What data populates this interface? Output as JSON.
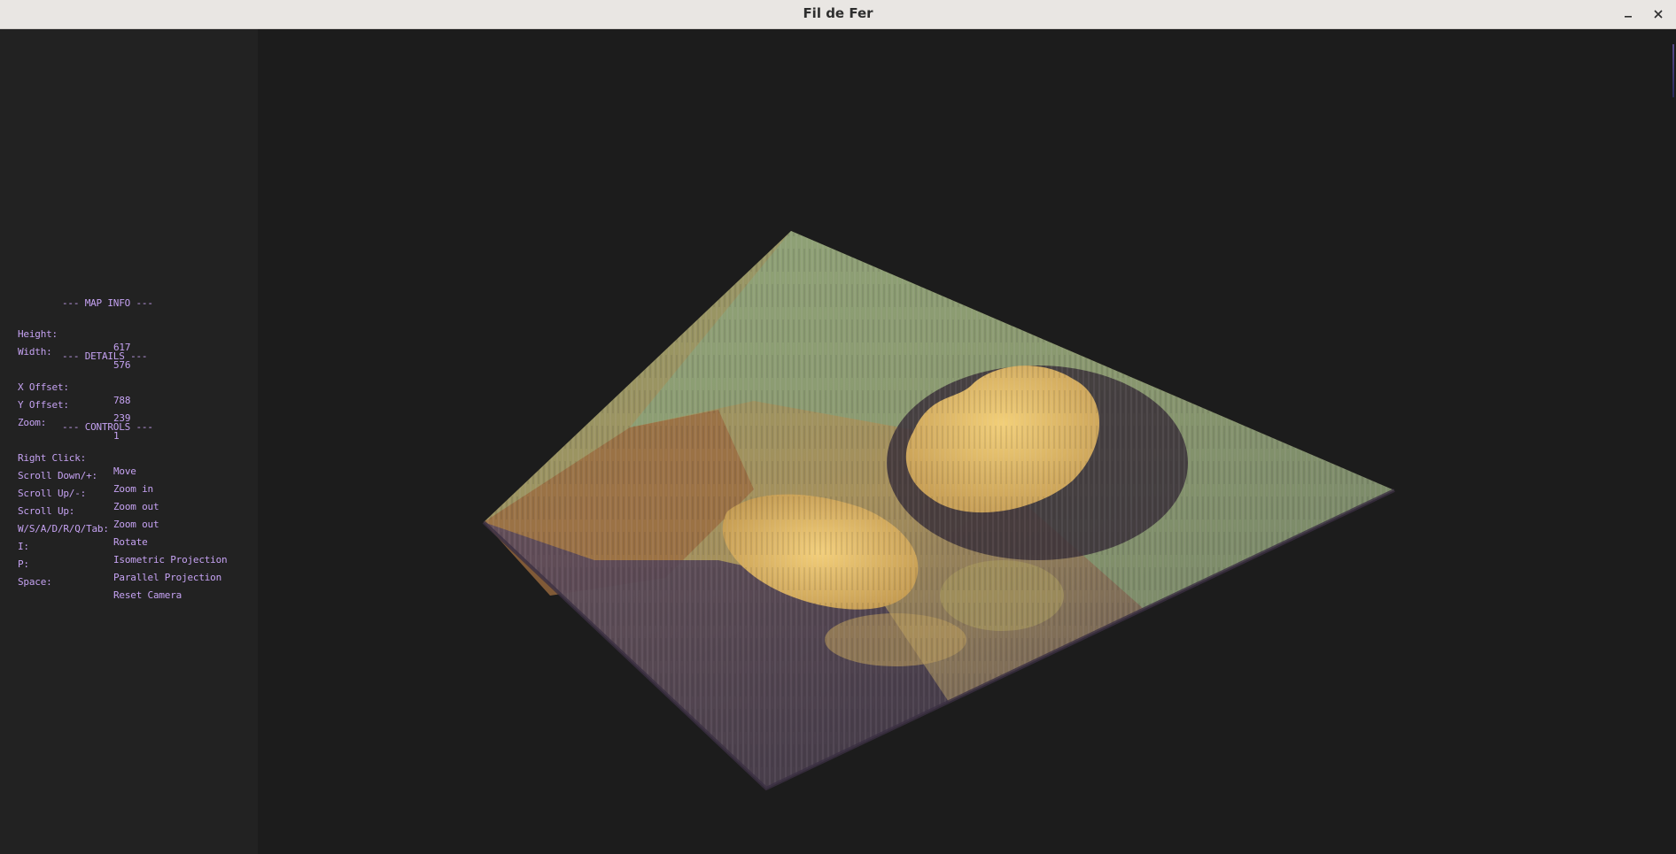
{
  "window": {
    "title": "Fil de Fer",
    "minimize_icon": "minimize-icon",
    "close_icon": "close-icon"
  },
  "sidebar": {
    "color": "#c5a2f2",
    "map_info_header": "--- MAP INFO ---",
    "map_info": [
      {
        "key": "Height:",
        "value": "617"
      },
      {
        "key": "Width:",
        "value": "576"
      }
    ],
    "details_header": "--- DETAILS ---",
    "details": [
      {
        "key": "X Offset:",
        "value": "788"
      },
      {
        "key": "Y Offset:",
        "value": "239"
      },
      {
        "key": "Zoom:",
        "value": "1"
      }
    ],
    "controls_header": "--- CONTROLS ---",
    "controls": [
      {
        "key": "Right Click:",
        "value": "Move"
      },
      {
        "key": "Scroll Down/+:",
        "value": "Zoom in"
      },
      {
        "key": "Scroll Up/-:",
        "value": "Zoom out"
      },
      {
        "key": "Scroll Up:",
        "value": "Zoom out"
      },
      {
        "key": "W/S/A/D/R/Q/Tab:",
        "value": "Rotate"
      },
      {
        "key": "I:",
        "value": "Isometric Projection"
      },
      {
        "key": "P:",
        "value": "Parallel Projection"
      },
      {
        "key": "Space:",
        "value": "Reset Camera"
      }
    ]
  },
  "colors": {
    "background": "#1c1c1c",
    "sidebar": "#222222",
    "titlebar": "#e9e6e3"
  }
}
